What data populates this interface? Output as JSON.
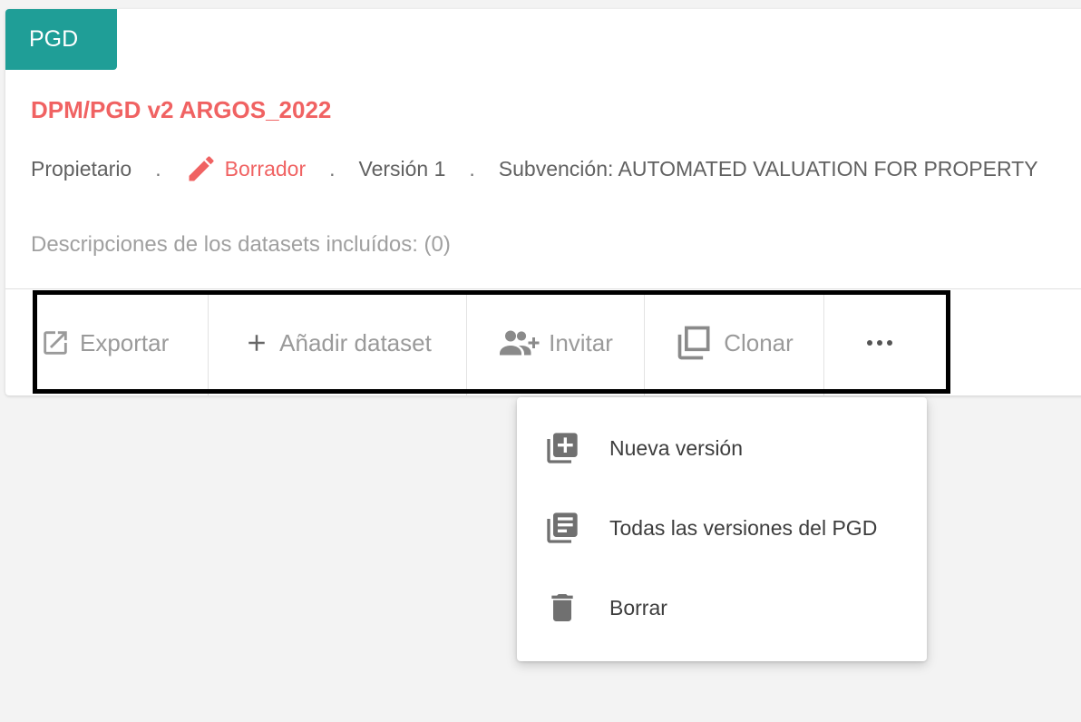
{
  "card": {
    "tag": "PGD",
    "title": "DPM/PGD v2 ARGOS_2022",
    "meta": {
      "role": "Propietario",
      "separator": ".",
      "status": "Borrador",
      "version": "Versión 1",
      "grant": "Subvención: AUTOMATED VALUATION FOR PROPERTY"
    },
    "datasets_description": "Descripciones de los datasets incluídos: (0)"
  },
  "actions": {
    "export": "Exportar",
    "add_dataset": "Añadir dataset",
    "invite": "Invitar",
    "clone": "Clonar"
  },
  "more_menu": {
    "items": [
      {
        "label": "Nueva versión",
        "icon": "library-add-icon"
      },
      {
        "label": "Todas las versiones del PGD",
        "icon": "library-books-icon"
      },
      {
        "label": "Borrar",
        "icon": "delete-icon"
      }
    ]
  },
  "colors": {
    "tag_background": "#1f9e97",
    "title": "#f06262",
    "status": "#f06262",
    "highlight_border": "#000000"
  }
}
